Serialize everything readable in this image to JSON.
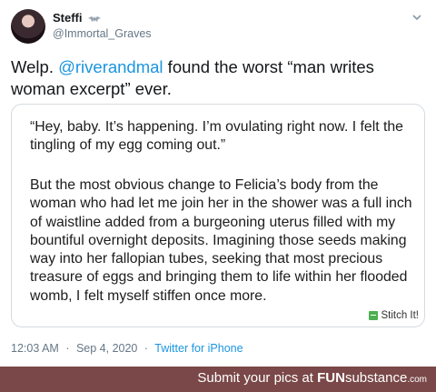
{
  "tweet": {
    "display_name": "Steffi",
    "handle": "@Immortal_Graves",
    "avatar_icon": "profile-photo",
    "badge_icon": "bat-icon",
    "menu_icon": "chevron-down-icon",
    "text_before": "Welp. ",
    "mention": "@riverandmal",
    "text_after": " found the worst “man writes woman excerpt” ever.",
    "quote_paragraph_1": "“Hey, baby. It’s happening. I’m ovulating right now. I felt the tingling of my egg coming out.”",
    "quote_paragraph_2": "But the most obvious change to Felicia’s body from the woman who had let me join her in the shower was a full inch of waistline added from a burgeoning uterus filled with my bountiful overnight deposits. Imagining those seeds making way into her fallopian tubes, seeking that most precious treasure of eggs and bringing them to life within her flooded womb, I felt myself stiffen once more.",
    "stitch_label": "Stitch It!",
    "time": "12:03 AM",
    "date": "Sep 4, 2020",
    "separator": "·",
    "source": "Twitter for iPhone"
  },
  "footer": {
    "prefix": "Submit your pics at ",
    "brand_bold": "FUN",
    "brand_rest": "substance",
    "domain": ".com"
  },
  "colors": {
    "mention": "#1b95e0",
    "footer_bg": "#7a4848",
    "meta_gray": "#657786"
  }
}
